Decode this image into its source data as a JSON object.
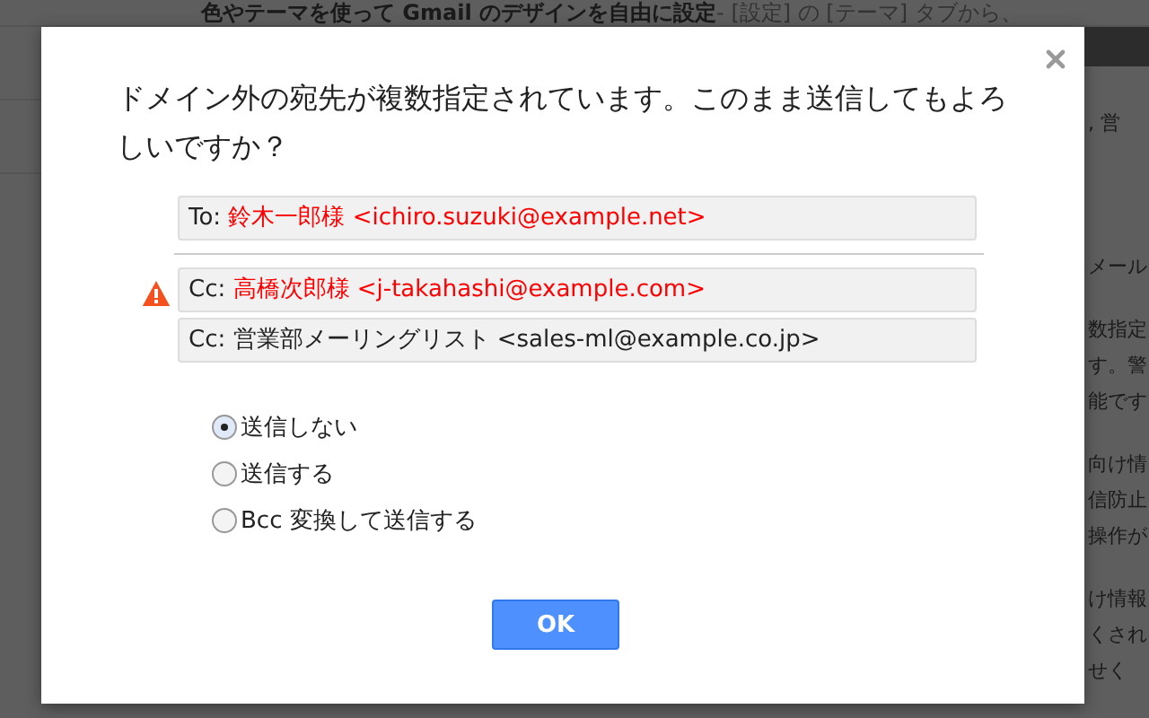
{
  "background": {
    "header": {
      "title": "色やテーマを使って Gmail のデザインを自由に設定",
      "snippet": " - [設定] の [テーマ] タブから、"
    },
    "side_fragments": [
      ", 営",
      "メール",
      "数指定",
      "す。警",
      "能です",
      "向け情",
      "信防止",
      "操作が",
      "け情報",
      "くされ",
      "せく"
    ]
  },
  "dialog": {
    "message": "ドメイン外の宛先が複数指定されています。このまま送信してもよろしいですか？",
    "recipients": [
      {
        "field": "To:",
        "address": "鈴木一郎様 <ichiro.suzuki@example.net>",
        "external": true,
        "warning": false,
        "divider_after": true
      },
      {
        "field": "Cc:",
        "address": "高橋次郎様 <j-takahashi@example.com>",
        "external": true,
        "warning": true,
        "divider_after": false
      },
      {
        "field": "Cc:",
        "address": "営業部メーリングリスト <sales-ml@example.co.jp>",
        "external": false,
        "warning": false,
        "divider_after": false
      }
    ],
    "options": [
      {
        "label": "送信しない",
        "selected": true
      },
      {
        "label": "送信する",
        "selected": false
      },
      {
        "label": "Bcc 変換して送信する",
        "selected": false
      }
    ],
    "ok_button": "OK"
  }
}
